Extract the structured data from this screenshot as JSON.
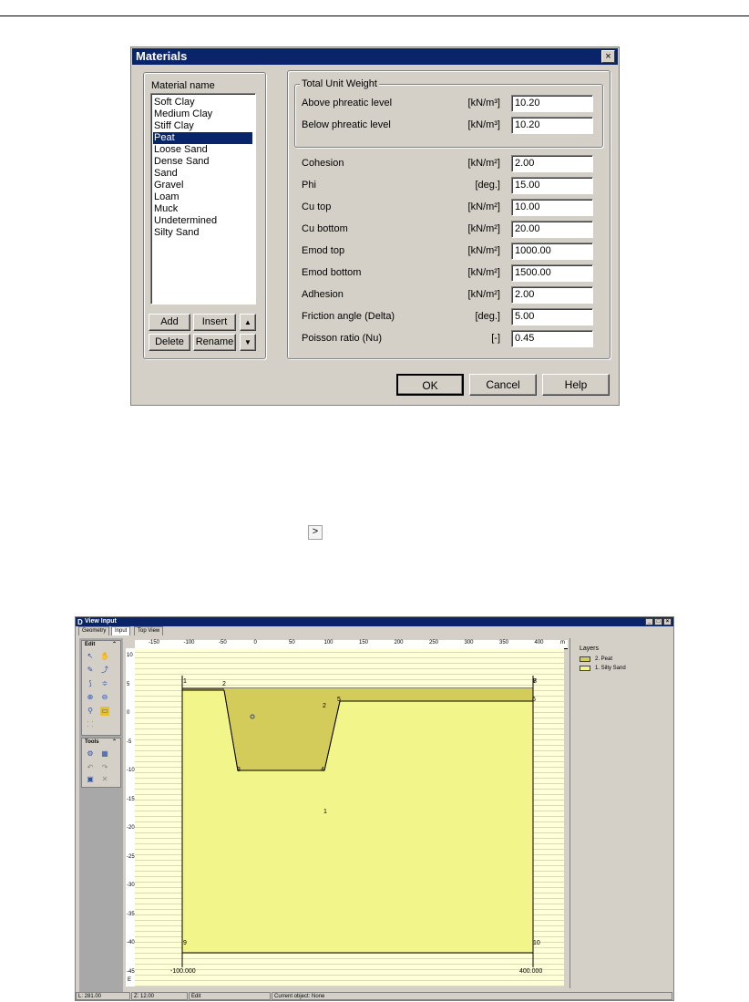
{
  "materials_dialog": {
    "title": "Materials",
    "close_glyph": "×",
    "material_name_label": "Material name",
    "materials": [
      "Soft Clay",
      "Medium Clay",
      "Stiff Clay",
      "Peat",
      "Loose Sand",
      "Dense Sand",
      "Sand",
      "Gravel",
      "Loam",
      "Muck",
      "Undetermined",
      "Silty Sand"
    ],
    "selected_material": "Peat",
    "buttons": {
      "add": "Add",
      "insert": "Insert",
      "delete": "Delete",
      "rename": "Rename",
      "up": "▲",
      "down": "▼",
      "ok": "OK",
      "cancel": "Cancel",
      "help": "Help"
    },
    "total_unit_weight_label": "Total Unit Weight",
    "properties": [
      {
        "label": "Above phreatic level",
        "unit": "[kN/m³]",
        "value": "10.20"
      },
      {
        "label": "Below phreatic level",
        "unit": "[kN/m³]",
        "value": "10.20"
      },
      {
        "label": "Cohesion",
        "unit": "[kN/m²]",
        "value": "2.00"
      },
      {
        "label": "Phi",
        "unit": "[deg.]",
        "value": "15.00"
      },
      {
        "label": "Cu top",
        "unit": "[kN/m²]",
        "value": "10.00"
      },
      {
        "label": "Cu bottom",
        "unit": "[kN/m²]",
        "value": "20.00"
      },
      {
        "label": "Emod top",
        "unit": "[kN/m²]",
        "value": "1000.00"
      },
      {
        "label": "Emod bottom",
        "unit": "[kN/m²]",
        "value": "1500.00"
      },
      {
        "label": "Adhesion",
        "unit": "[kN/m²]",
        "value": "2.00"
      },
      {
        "label": "Friction angle (Delta)",
        "unit": "[deg.]",
        "value": "5.00"
      },
      {
        "label": "Poisson ratio (Nu)",
        "unit": "[-]",
        "value": "0.45"
      }
    ]
  },
  "arrow_button": {
    "glyph": ">"
  },
  "view_input": {
    "title": "View Input",
    "logo": "D",
    "window_buttons": [
      "_",
      "□",
      "×"
    ],
    "tabs": [
      "Geometry",
      "Input",
      "Top View"
    ],
    "active_tab": "Input",
    "edit_palette_title": "Edit",
    "tools_palette_title": "Tools",
    "top_ruler_ticks": [
      "-150",
      "-100",
      "-50",
      "0",
      "50",
      "100",
      "150",
      "200",
      "250",
      "300",
      "350",
      "400"
    ],
    "top_ruler_unit": "m",
    "left_ruler_ticks": [
      "10",
      "5",
      "0",
      "-5",
      "-10",
      "-15",
      "-20",
      "-25",
      "-30",
      "-35",
      "-40",
      "-45"
    ],
    "left_ruler_unit": "E",
    "layers_title": "Layers",
    "layers": [
      {
        "name": "2. Peat",
        "color": "#d4cc5a"
      },
      {
        "name": "1. Silty Sand",
        "color": "#f2f58a"
      }
    ],
    "point_labels": [
      "1",
      "2",
      "3",
      "4",
      "5",
      "6",
      "7",
      "8",
      "9",
      "10"
    ],
    "layer_labels": [
      "2",
      "1"
    ],
    "coord_left": "-100.000",
    "coord_right": "400.000",
    "status": {
      "l": "L: 281.00",
      "z": "Z: 12.00",
      "mode": "Edit",
      "current": "Current object: None"
    }
  }
}
